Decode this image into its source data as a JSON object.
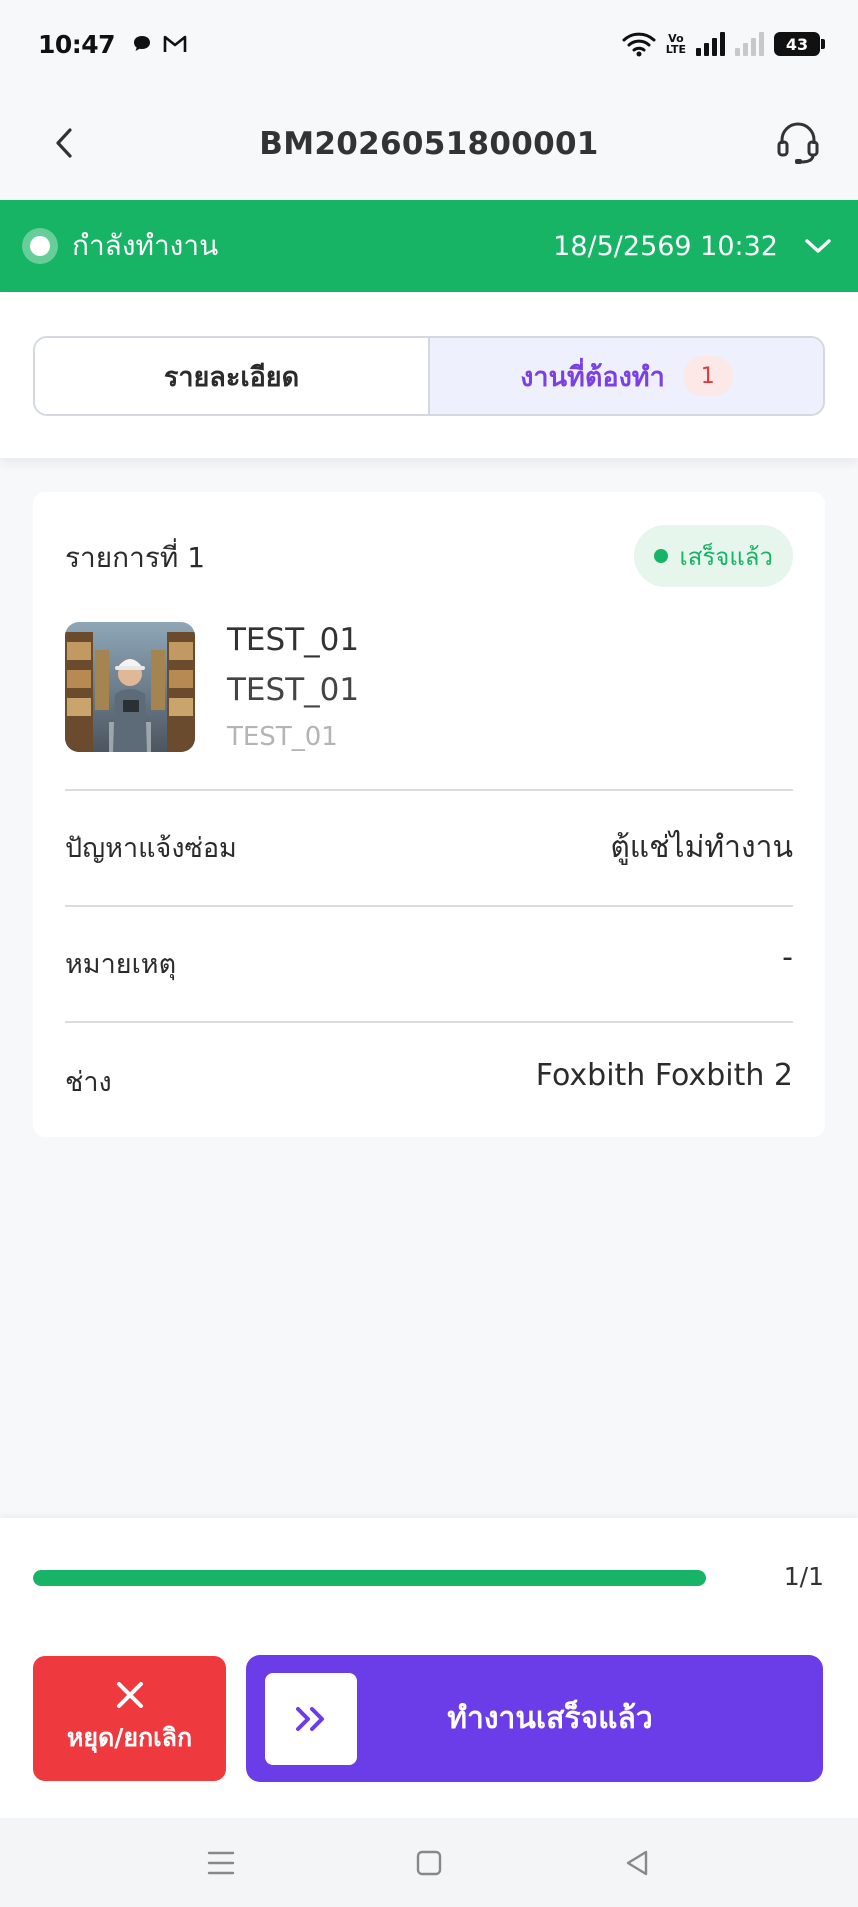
{
  "status_bar": {
    "time": "10:47",
    "volte_top": "Vo",
    "volte_bottom": "LTE",
    "battery": "43"
  },
  "header": {
    "title": "BM2026051800001"
  },
  "status_banner": {
    "label": "กำลังทำงาน",
    "datetime": "18/5/2569 10:32",
    "color": "#16b464"
  },
  "tabs": {
    "details_label": "รายละเอียด",
    "todo_label": "งานที่ต้องทำ",
    "todo_count": "1"
  },
  "item": {
    "title": "รายการที่ 1",
    "status": "เสร็จแล้ว",
    "name": "TEST_01",
    "code": "TEST_01",
    "sub": "TEST_01",
    "rows": [
      {
        "label": "ปัญหาแจ้งซ่อม",
        "value": "ตู้แช่ไม่ทำงาน"
      },
      {
        "label": "หมายเหตุ",
        "value": "-"
      },
      {
        "label": "ช่าง",
        "value": "Foxbith Foxbith 2"
      }
    ]
  },
  "progress": {
    "text": "1/1",
    "fraction": 1.0
  },
  "actions": {
    "cancel_label": "หยุด/ยกเลิก",
    "done_label": "ทำงานเสร็จแล้ว",
    "cancel_color": "#ee3a3f",
    "done_color": "#6a3de8"
  }
}
